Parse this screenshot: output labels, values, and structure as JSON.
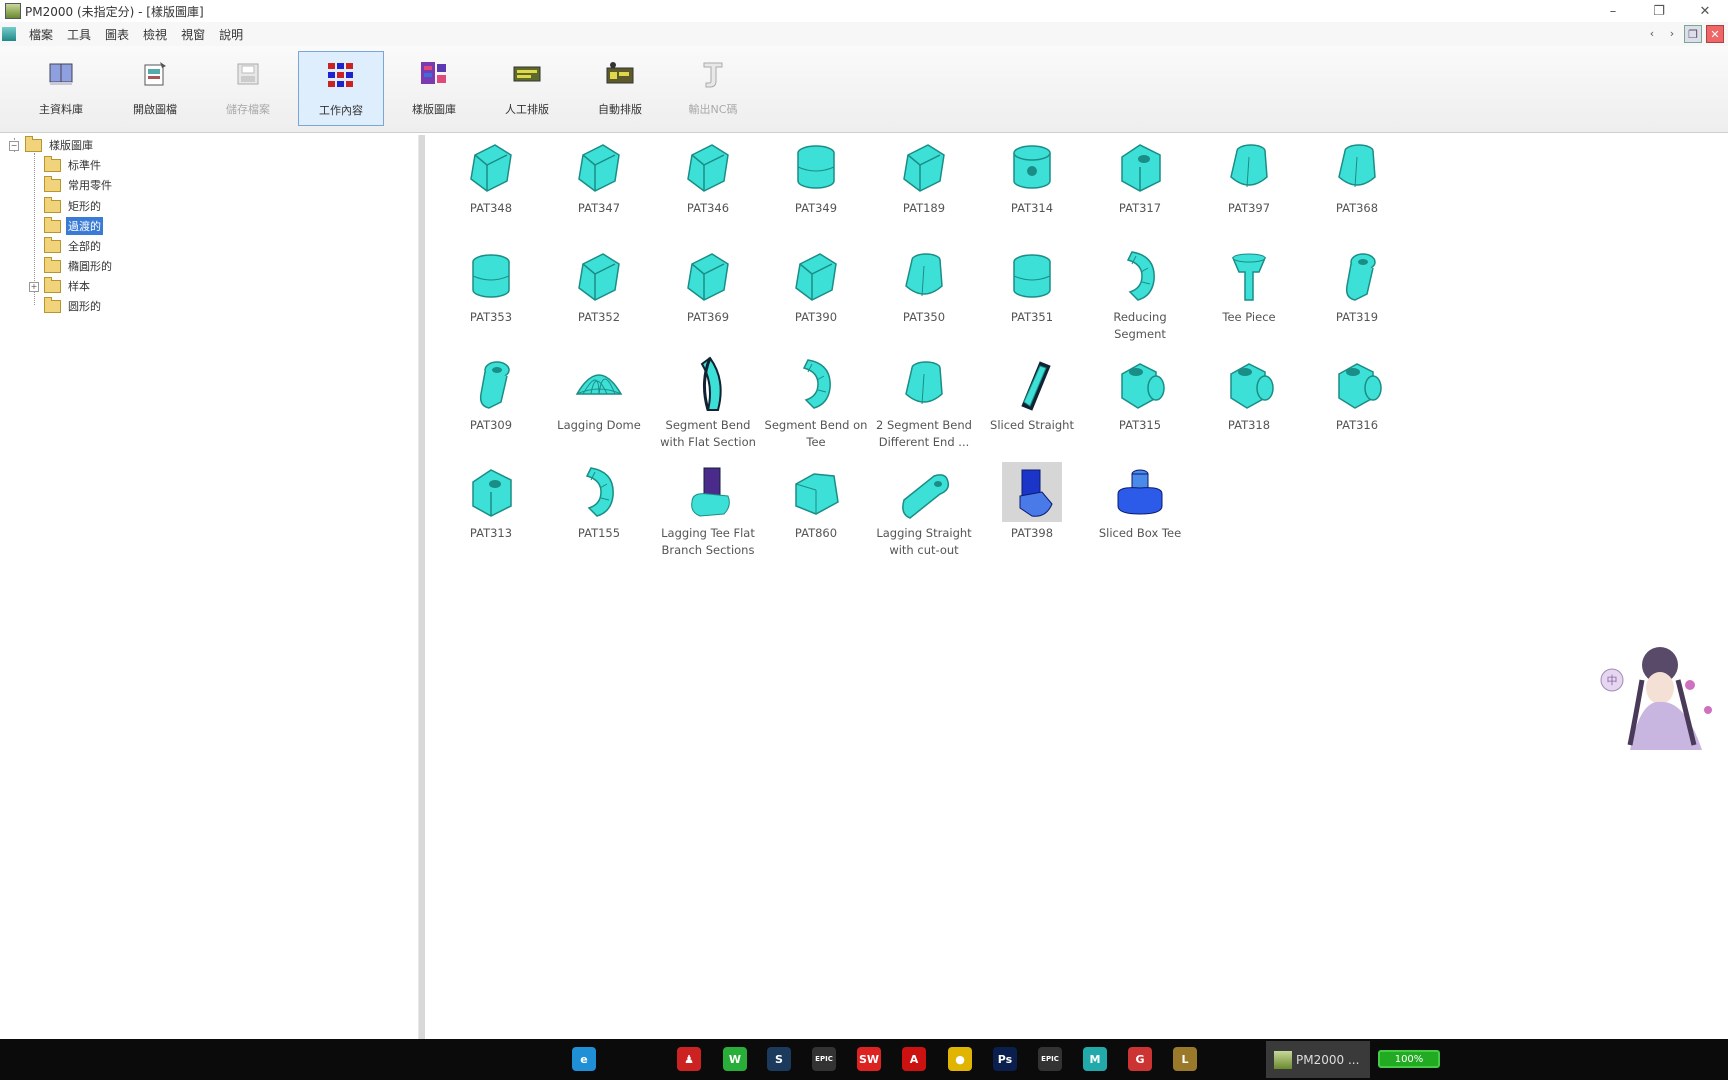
{
  "window": {
    "title": "PM2000 (未指定分) - [樣版圖庫]"
  },
  "menu": [
    "檔案",
    "工具",
    "圖表",
    "檢視",
    "視窗",
    "說明"
  ],
  "toolbar": [
    {
      "label": "主資料庫",
      "icon": "book-icon"
    },
    {
      "label": "開啟圖檔",
      "icon": "open-file-icon"
    },
    {
      "label": "儲存檔案",
      "icon": "save-icon",
      "disabled": true
    },
    {
      "label": "工作內容",
      "icon": "grid-icon",
      "active": true
    },
    {
      "label": "樣版圖庫",
      "icon": "pattern-library-icon"
    },
    {
      "label": "人工排版",
      "icon": "manual-nest-icon"
    },
    {
      "label": "自動排版",
      "icon": "auto-nest-icon"
    },
    {
      "label": "輸出NC碼",
      "icon": "nc-output-icon",
      "disabled": true
    }
  ],
  "tree": {
    "root": "樣版圖庫",
    "children": [
      {
        "label": "标準件"
      },
      {
        "label": "常用零件"
      },
      {
        "label": "矩形的"
      },
      {
        "label": "過渡的",
        "selected": true
      },
      {
        "label": "全部的"
      },
      {
        "label": "橢圓形的"
      },
      {
        "label": "样本",
        "expandable": true
      },
      {
        "label": "圆形的"
      }
    ]
  },
  "items": [
    {
      "label": "PAT348",
      "shape": "box"
    },
    {
      "label": "PAT347",
      "shape": "box"
    },
    {
      "label": "PAT346",
      "shape": "box"
    },
    {
      "label": "PAT349",
      "shape": "cyl"
    },
    {
      "label": "PAT189",
      "shape": "box"
    },
    {
      "label": "PAT314",
      "shape": "cylhole"
    },
    {
      "label": "PAT317",
      "shape": "boxhole"
    },
    {
      "label": "PAT397",
      "shape": "trans"
    },
    {
      "label": "PAT368",
      "shape": "trans"
    },
    {
      "label": "PAT353",
      "shape": "cyl"
    },
    {
      "label": "PAT352",
      "shape": "box"
    },
    {
      "label": "PAT369",
      "shape": "box"
    },
    {
      "label": "PAT390",
      "shape": "box"
    },
    {
      "label": "PAT350",
      "shape": "trans"
    },
    {
      "label": "PAT351",
      "shape": "cyl"
    },
    {
      "label": "Reducing Segment",
      "shape": "bend"
    },
    {
      "label": "Tee Piece",
      "shape": "tee"
    },
    {
      "label": "PAT319",
      "shape": "teebend"
    },
    {
      "label": "PAT309",
      "shape": "teebend"
    },
    {
      "label": "Lagging Dome",
      "shape": "dome"
    },
    {
      "label": "Segment Bend with Flat Section",
      "shape": "darkbend"
    },
    {
      "label": "Segment Bend on Tee",
      "shape": "bend"
    },
    {
      "label": "2 Segment Bend Different End ...",
      "shape": "trans"
    },
    {
      "label": "Sliced Straight",
      "shape": "sliced"
    },
    {
      "label": "PAT315",
      "shape": "boxcyl"
    },
    {
      "label": "PAT318",
      "shape": "boxcyl"
    },
    {
      "label": "PAT316",
      "shape": "boxcyl"
    },
    {
      "label": "PAT313",
      "shape": "boxhole"
    },
    {
      "label": "PAT155",
      "shape": "bend"
    },
    {
      "label": "Lagging Tee Flat Branch Sections",
      "shape": "laggingtee"
    },
    {
      "label": "PAT860",
      "shape": "flat"
    },
    {
      "label": "Lagging Straight with cut-out",
      "shape": "straight"
    },
    {
      "label": "PAT398",
      "shape": "blue",
      "selected": true
    },
    {
      "label": "Sliced Box Tee",
      "shape": "bluetee"
    }
  ],
  "taskbar": {
    "active_app_label": "PM2000 ...",
    "battery_label": "100%",
    "icons": [
      {
        "name": "edge-icon",
        "color": "#1f8fd6",
        "text": "e"
      },
      {
        "name": "app-red-icon",
        "color": "#c22",
        "text": "♟"
      },
      {
        "name": "wechat-icon",
        "color": "#2aae3a",
        "text": "W"
      },
      {
        "name": "steam-icon",
        "color": "#1b3a5c",
        "text": "S"
      },
      {
        "name": "epic-icon",
        "color": "#333",
        "text": "EPIC"
      },
      {
        "name": "solidworks-icon",
        "color": "#d22",
        "text": "SW"
      },
      {
        "name": "autocad-icon",
        "color": "#c11",
        "text": "A"
      },
      {
        "name": "chrome-icon",
        "color": "#e0b400",
        "text": "●"
      },
      {
        "name": "photoshop-icon",
        "color": "#0a1f4d",
        "text": "Ps"
      },
      {
        "name": "epic2-icon",
        "color": "#333",
        "text": "EPIC"
      },
      {
        "name": "mapping-icon",
        "color": "#2aa",
        "text": "M"
      },
      {
        "name": "garena-icon",
        "color": "#c33",
        "text": "G"
      },
      {
        "name": "league-icon",
        "color": "#9a7a2a",
        "text": "L"
      }
    ]
  },
  "colors": {
    "pattern": "#3de0d6",
    "pattern_dark": "#1a8d86",
    "selection_blue": "#3a7bd5",
    "part_blue": "#2b5be8"
  }
}
